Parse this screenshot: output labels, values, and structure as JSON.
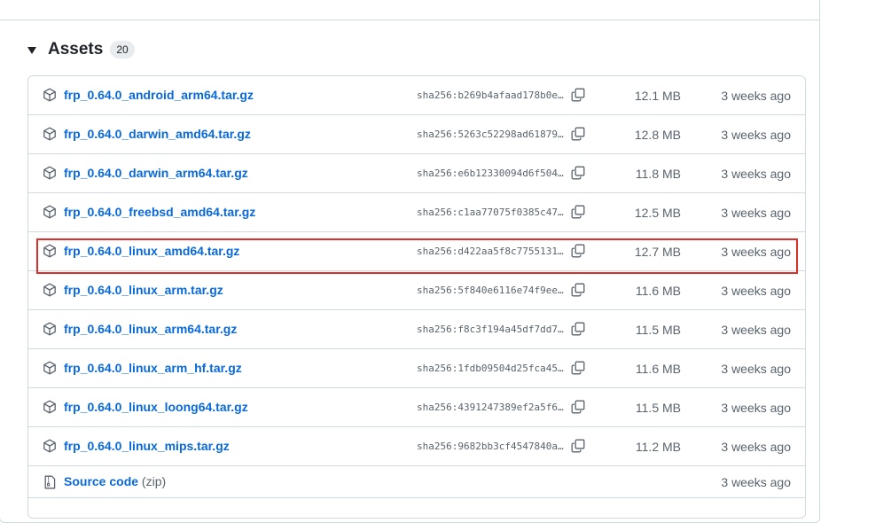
{
  "assets": {
    "title": "Assets",
    "count": "20",
    "items": [
      {
        "name": "frp_0.64.0_android_arm64.tar.gz",
        "sha": "sha256:b269b4afaad178b0e…",
        "size": "12.1 MB",
        "date": "3 weeks ago"
      },
      {
        "name": "frp_0.64.0_darwin_amd64.tar.gz",
        "sha": "sha256:5263c52298ad61879…",
        "size": "12.8 MB",
        "date": "3 weeks ago"
      },
      {
        "name": "frp_0.64.0_darwin_arm64.tar.gz",
        "sha": "sha256:e6b12330094d6f504…",
        "size": "11.8 MB",
        "date": "3 weeks ago"
      },
      {
        "name": "frp_0.64.0_freebsd_amd64.tar.gz",
        "sha": "sha256:c1aa77075f0385c47…",
        "size": "12.5 MB",
        "date": "3 weeks ago"
      },
      {
        "name": "frp_0.64.0_linux_amd64.tar.gz",
        "sha": "sha256:d422aa5f8c7755131…",
        "size": "12.7 MB",
        "date": "3 weeks ago"
      },
      {
        "name": "frp_0.64.0_linux_arm.tar.gz",
        "sha": "sha256:5f840e6116e74f9ee…",
        "size": "11.6 MB",
        "date": "3 weeks ago"
      },
      {
        "name": "frp_0.64.0_linux_arm64.tar.gz",
        "sha": "sha256:f8c3f194a45df7dd7…",
        "size": "11.5 MB",
        "date": "3 weeks ago"
      },
      {
        "name": "frp_0.64.0_linux_arm_hf.tar.gz",
        "sha": "sha256:1fdb09504d25fca45…",
        "size": "11.6 MB",
        "date": "3 weeks ago"
      },
      {
        "name": "frp_0.64.0_linux_loong64.tar.gz",
        "sha": "sha256:4391247389ef2a5f6…",
        "size": "11.5 MB",
        "date": "3 weeks ago"
      },
      {
        "name": "frp_0.64.0_linux_mips.tar.gz",
        "sha": "sha256:9682bb3cf4547840a…",
        "size": "11.2 MB",
        "date": "3 weeks ago"
      }
    ],
    "source": {
      "name": "Source code",
      "suffix": "(zip)",
      "date": "3 weeks ago"
    }
  },
  "colors": {
    "link": "#0969da",
    "muted": "#59636e",
    "border": "#d1d9e0",
    "highlight": "#d9302c"
  },
  "icons": {
    "asset": "package-icon",
    "source": "file-zip-icon",
    "copy": "copy-icon",
    "caret": "triangle-down-icon"
  }
}
